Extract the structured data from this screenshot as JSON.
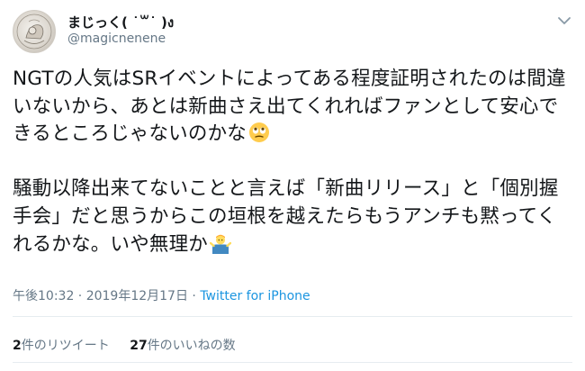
{
  "user": {
    "display_name": "まじっく( ˙꒳​˙ )ง",
    "handle": "@magicnenene"
  },
  "tweet": {
    "paragraph1": "NGTの人気はSRイベントによってある程度証明されたのは間違いないから、あとは新曲さえ出てくれればファンとして安心できるところじゃないのかな",
    "paragraph1_emoji": "face-with-rolling-eyes-emoji",
    "paragraph2": "騒動以降出来てないことと言えば「新曲リリース」と「個別握手会」だと思うからこの垣根を越えたらもうアンチも黙ってくれるかな。いや無理か",
    "paragraph2_emoji": "person-shrugging-emoji"
  },
  "meta": {
    "datetime": "午後10:32 · 2019年12月17日 · ",
    "source": "Twitter for iPhone"
  },
  "stats": {
    "retweets_count": "2",
    "retweets_label": "件のリツイート",
    "likes_count": "27",
    "likes_label": "件のいいねの数"
  },
  "icons": {
    "menu": "chevron-down-icon"
  },
  "colors": {
    "link": "#1b95e0",
    "secondary_text": "#657786",
    "divider": "#e6ecf0"
  }
}
